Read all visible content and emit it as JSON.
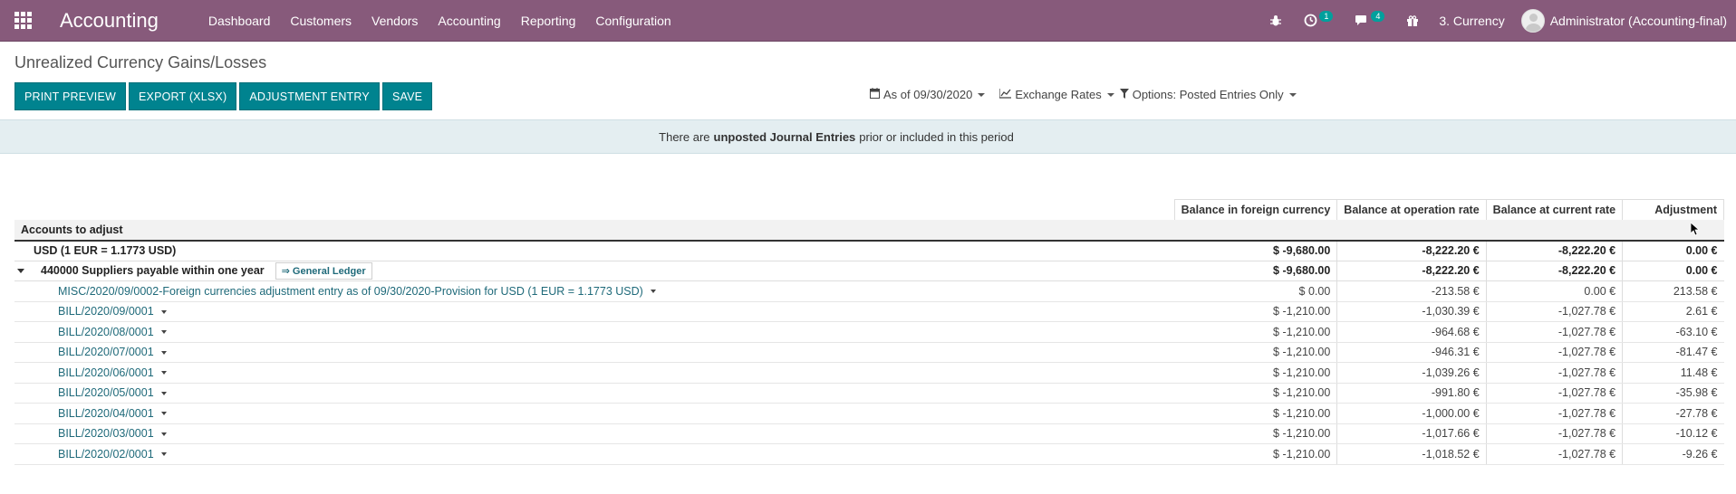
{
  "navbar": {
    "app_name": "Accounting",
    "menu": [
      "Dashboard",
      "Customers",
      "Vendors",
      "Accounting",
      "Reporting",
      "Configuration"
    ],
    "activity_count": "1",
    "messages_count": "4",
    "company": "3. Currency",
    "user": "Administrator (Accounting-final)",
    "icons": [
      "apps-grid-icon",
      "bug-icon",
      "clock-icon",
      "chat-icon",
      "gift-icon"
    ],
    "color": "#875a7b"
  },
  "page": {
    "title": "Unrealized Currency Gains/Losses",
    "buttons": {
      "print_preview": "PRINT PREVIEW",
      "export_xlsx": "EXPORT (XLSX)",
      "adjustment_entry": "ADJUSTMENT ENTRY",
      "save": "SAVE"
    },
    "button_color": "#00838f",
    "filters": {
      "date": "As of 09/30/2020",
      "exchange_rates": "Exchange Rates",
      "options": "Options: Posted Entries Only"
    }
  },
  "alert": {
    "prefix": "There are",
    "bold": "unposted Journal Entries",
    "suffix": "prior or included in this period"
  },
  "table": {
    "columns": [
      "Balance in foreign currency",
      "Balance at operation rate",
      "Balance at current rate",
      "Adjustment"
    ],
    "section_header": "Accounts to adjust",
    "currency_row": {
      "label": "USD (1 EUR = 1.1773 USD)",
      "values": [
        "$ -9,680.00",
        "-8,222.20 €",
        "-8,222.20 €",
        "0.00 €"
      ]
    },
    "account_row": {
      "label": "440000 Suppliers payable within one year",
      "gl_button": "⇒ General Ledger",
      "values": [
        "$ -9,680.00",
        "-8,222.20 €",
        "-8,222.20 €",
        "0.00 €"
      ]
    },
    "lines": [
      {
        "label": "MISC/2020/09/0002-Foreign currencies adjustment entry as of 09/30/2020-Provision for USD (1 EUR = 1.1773 USD)",
        "values": [
          "$ 0.00",
          "-213.58 €",
          "0.00 €",
          "213.58 €"
        ]
      },
      {
        "label": "BILL/2020/09/0001",
        "values": [
          "$ -1,210.00",
          "-1,030.39 €",
          "-1,027.78 €",
          "2.61 €"
        ]
      },
      {
        "label": "BILL/2020/08/0001",
        "values": [
          "$ -1,210.00",
          "-964.68 €",
          "-1,027.78 €",
          "-63.10 €"
        ]
      },
      {
        "label": "BILL/2020/07/0001",
        "values": [
          "$ -1,210.00",
          "-946.31 €",
          "-1,027.78 €",
          "-81.47 €"
        ]
      },
      {
        "label": "BILL/2020/06/0001",
        "values": [
          "$ -1,210.00",
          "-1,039.26 €",
          "-1,027.78 €",
          "11.48 €"
        ]
      },
      {
        "label": "BILL/2020/05/0001",
        "values": [
          "$ -1,210.00",
          "-991.80 €",
          "-1,027.78 €",
          "-35.98 €"
        ]
      },
      {
        "label": "BILL/2020/04/0001",
        "values": [
          "$ -1,210.00",
          "-1,000.00 €",
          "-1,027.78 €",
          "-27.78 €"
        ]
      },
      {
        "label": "BILL/2020/03/0001",
        "values": [
          "$ -1,210.00",
          "-1,017.66 €",
          "-1,027.78 €",
          "-10.12 €"
        ]
      },
      {
        "label": "BILL/2020/02/0001",
        "values": [
          "$ -1,210.00",
          "-1,018.52 €",
          "-1,027.78 €",
          "-9.26 €"
        ]
      }
    ]
  }
}
